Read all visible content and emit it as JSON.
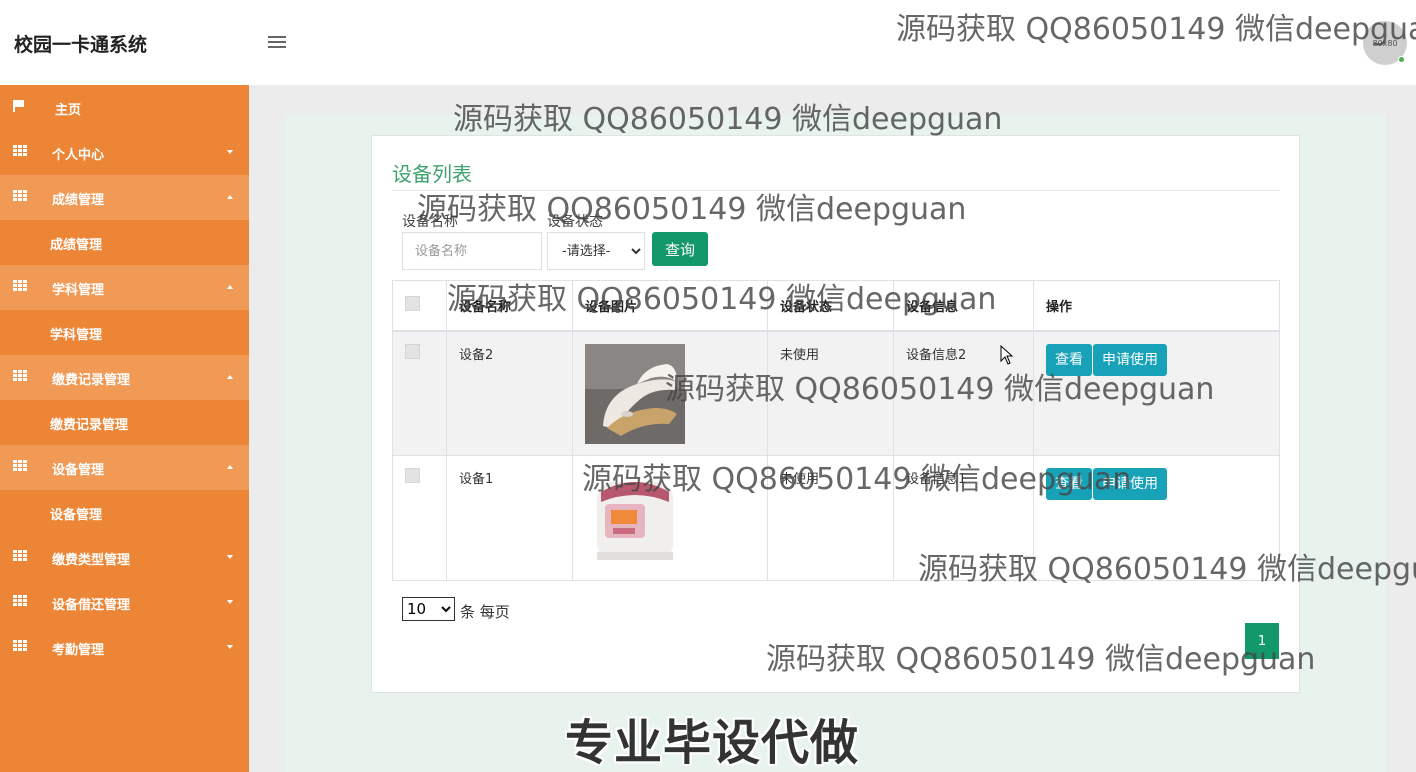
{
  "header": {
    "app_title": "校园一卡通系统",
    "avatar_text": "80x80"
  },
  "sidebar": {
    "items": [
      {
        "label": "主页",
        "icon": "flag-icon"
      },
      {
        "label": "个人中心",
        "icon": "grid-icon"
      },
      {
        "label": "成绩管理",
        "icon": "grid-icon"
      },
      {
        "label": "成绩管理"
      },
      {
        "label": "学科管理",
        "icon": "grid-icon"
      },
      {
        "label": "学科管理"
      },
      {
        "label": "缴费记录管理",
        "icon": "grid-icon"
      },
      {
        "label": "缴费记录管理"
      },
      {
        "label": "设备管理",
        "icon": "grid-icon"
      },
      {
        "label": "设备管理"
      },
      {
        "label": "缴费类型管理",
        "icon": "grid-icon"
      },
      {
        "label": "设备借还管理",
        "icon": "grid-icon"
      },
      {
        "label": "考勤管理",
        "icon": "grid-icon"
      }
    ]
  },
  "main": {
    "title": "设备列表",
    "search": {
      "name_label": "设备名称",
      "name_placeholder": "设备名称",
      "status_label": "设备状态",
      "status_selected": "-请选择-",
      "query_button": "查询"
    },
    "table": {
      "headers": [
        "设备名称",
        "设备图片",
        "设备状态",
        "设备信息",
        "操作"
      ],
      "rows": [
        {
          "name": "设备2",
          "image": "iron-photo",
          "status": "未使用",
          "info": "设备信息2",
          "view": "查看",
          "apply": "申请使用"
        },
        {
          "name": "设备1",
          "image": "rice-cooker-photo",
          "status": "未使用",
          "info": "设备信息1",
          "view": "查看",
          "apply": "申请使用"
        }
      ]
    },
    "pagination": {
      "page_size": "10",
      "page_size_suffix": "条 每页",
      "current_page": "1"
    }
  },
  "watermark": "源码获取 QQ86050149 微信deepguan",
  "banner": "专业毕设代做",
  "colors": {
    "sidebar": "#ec8636",
    "sidebar_open": "#f09a55",
    "primary_green": "#13986b",
    "title_green": "#3fa370",
    "teal": "#17a2b8"
  }
}
